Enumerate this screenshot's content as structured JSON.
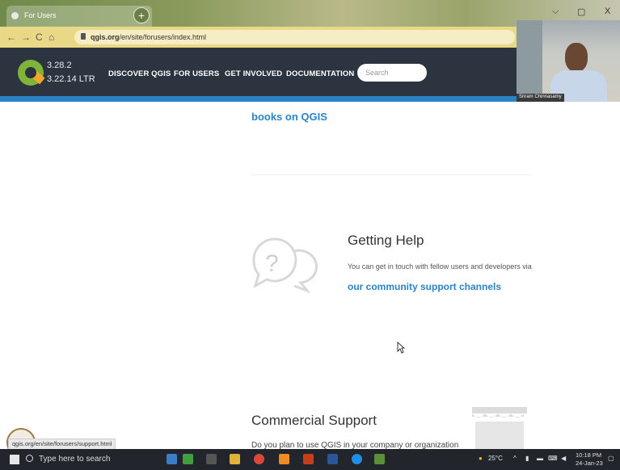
{
  "browser": {
    "tab_title": "For Users",
    "tab_close": "×",
    "new_tab": "+",
    "window_controls": {
      "minimize": "⌵",
      "maximize": "▢",
      "close": "X"
    },
    "nav": {
      "back": "←",
      "forward": "→",
      "reload": "C",
      "home": "⌂"
    },
    "url_host": "qgis.org",
    "url_path": "/en/site/forusers/index.html"
  },
  "header": {
    "version_latest": "3.28.2",
    "version_ltr": "3.22.14 LTR",
    "menu": [
      "DISCOVER QGIS",
      "FOR USERS",
      "GET INVOLVED",
      "DOCUMENTATION"
    ],
    "search_placeholder": "Search"
  },
  "webcam": {
    "name": "Sriram Chinnasamy"
  },
  "content": {
    "books_link": "books on QGIS",
    "getting_help": {
      "title": "Getting Help",
      "text": "You can get in touch with fellow users and developers via",
      "link": "our community support channels"
    },
    "commercial_support": {
      "title": "Commercial Support",
      "text": "Do you plan to use QGIS in your company or organization"
    }
  },
  "status_url": "qgis.org/en/site/forusers/support.html",
  "taskbar": {
    "search_placeholder": "Type here to search",
    "weather": "25°C",
    "time": "10:18 PM",
    "date": "24-Jan-23"
  },
  "colors": {
    "accent": "#2b83c7",
    "header_bg": "#2c3440",
    "taskbar_bg": "#22252b"
  }
}
